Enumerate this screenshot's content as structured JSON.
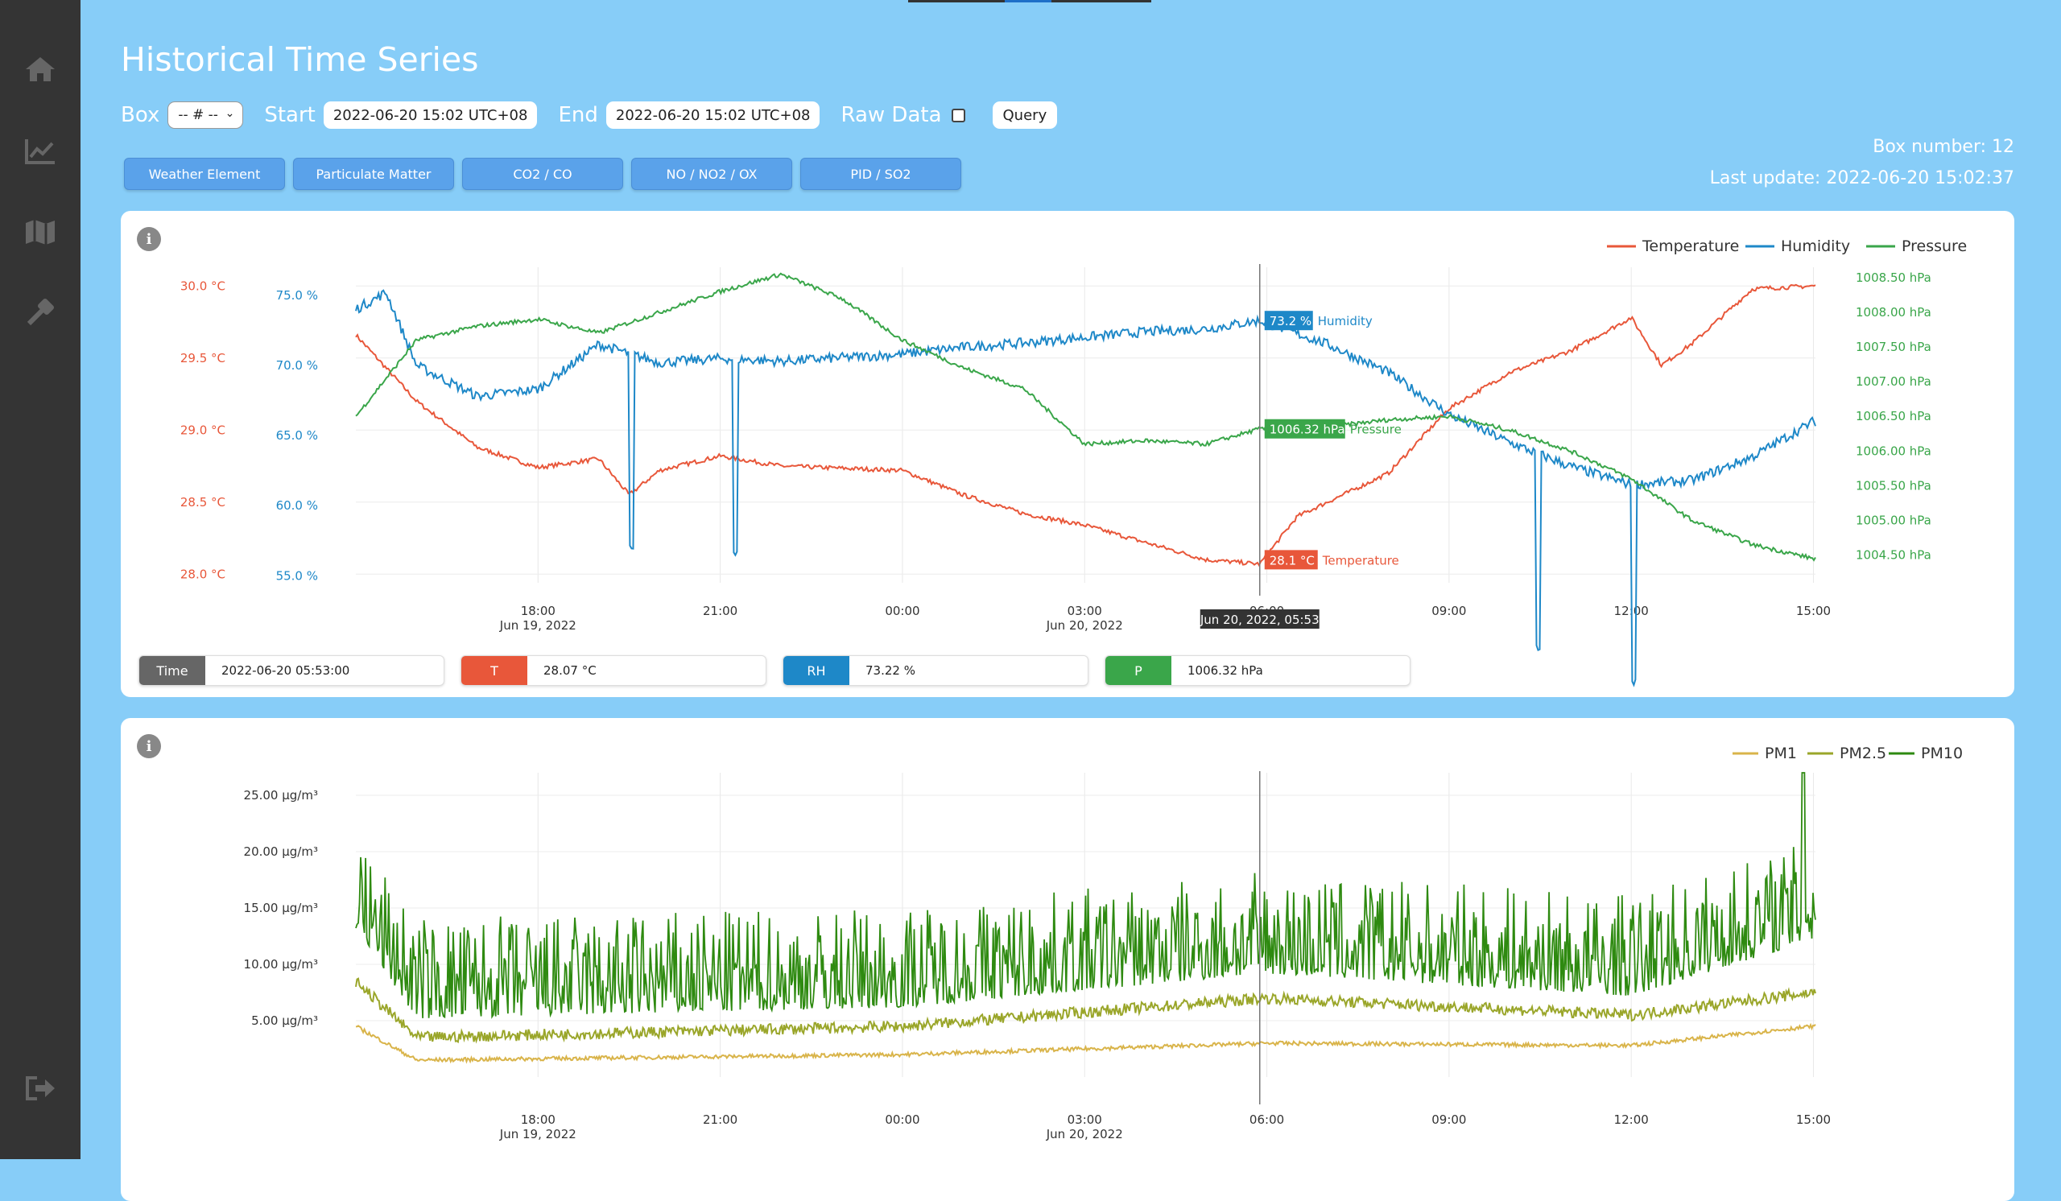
{
  "app": {
    "title": "Historical Time Series"
  },
  "sidebar": {
    "items": [
      {
        "icon": "home-icon"
      },
      {
        "icon": "chart-line-icon"
      },
      {
        "icon": "map-icon"
      },
      {
        "icon": "wrench-icon"
      }
    ],
    "logout_icon": "logout-icon"
  },
  "toolbar": {
    "box_label": "Box",
    "box_value": "-- # --",
    "start_label": "Start",
    "start_value": "2022-06-20 15:02 UTC+08",
    "end_label": "End",
    "end_value": "2022-06-20 15:02 UTC+08",
    "raw_label": "Raw Data",
    "raw_checked": false,
    "query_label": "Query"
  },
  "category_tabs": [
    "Weather Element",
    "Particulate Matter",
    "CO2 / CO",
    "NO / NO2 / OX",
    "PID / SO2"
  ],
  "box_info": {
    "box_number": "Box number: 12",
    "last_update": "Last update: 2022-06-20 15:02:37"
  },
  "colors": {
    "temperature": "#e8573a",
    "humidity": "#1e88c8",
    "pressure": "#3aa64a",
    "pm1": "#d9b44a",
    "pm25": "#9aa62a",
    "pm10": "#2e8a10",
    "time_tag": "#666666"
  },
  "x_axis": {
    "ticks": [
      "18:00",
      "21:00",
      "00:00",
      "03:00",
      "06:00",
      "09:00",
      "12:00",
      "15:00"
    ],
    "date_labels": [
      "Jun 19, 2022",
      "Jun 20, 2022"
    ],
    "range": [
      "2022-06-19 15:00",
      "2022-06-20 15:02"
    ]
  },
  "chart_data": [
    {
      "type": "line",
      "title": "",
      "legend": [
        "Temperature",
        "Humidity",
        "Pressure"
      ],
      "legend_position": "top-right",
      "cursor_label": "Jun 20, 2022, 05:53",
      "cursor_tags": {
        "humidity": "73.2 %",
        "humidity_name": "Humidity",
        "pressure": "1006.32 hPa",
        "pressure_name": "Pressure",
        "temperature": "28.1 °C",
        "temperature_name": "Temperature"
      },
      "axes": {
        "temperature": {
          "ticks": [
            "30.0 °C",
            "29.5 °C",
            "29.0 °C",
            "28.5 °C",
            "28.0 °C"
          ],
          "ylim": [
            27.94,
            30.13
          ]
        },
        "humidity": {
          "ticks": [
            "75.0 %",
            "70.0 %",
            "65.0 %",
            "60.0 %",
            "55.0 %"
          ],
          "ylim": [
            54.5,
            77.0
          ]
        },
        "pressure": {
          "ticks": [
            "1008.50 hPa",
            "1008.00 hPa",
            "1007.50 hPa",
            "1007.00 hPa",
            "1006.50 hPa",
            "1006.00 hPa",
            "1005.50 hPa",
            "1005.00 hPa",
            "1004.50 hPa"
          ],
          "ylim": [
            1004.1,
            1008.65
          ]
        }
      },
      "series": [
        {
          "name": "Temperature",
          "axis": "temperature",
          "x": [
            "2022-06-19 15:00",
            "2022-06-19 16:00",
            "2022-06-19 17:00",
            "2022-06-19 18:00",
            "2022-06-19 19:00",
            "2022-06-19 19:30",
            "2022-06-19 20:00",
            "2022-06-19 21:00",
            "2022-06-19 22:00",
            "2022-06-20 00:00",
            "2022-06-20 01:00",
            "2022-06-20 02:00",
            "2022-06-20 03:00",
            "2022-06-20 04:00",
            "2022-06-20 05:00",
            "2022-06-20 05:53",
            "2022-06-20 06:30",
            "2022-06-20 08:00",
            "2022-06-20 09:00",
            "2022-06-20 10:00",
            "2022-06-20 11:00",
            "2022-06-20 12:00",
            "2022-06-20 12:30",
            "2022-06-20 13:00",
            "2022-06-20 14:00",
            "2022-06-20 15:00"
          ],
          "values": [
            29.66,
            29.2,
            28.88,
            28.74,
            28.8,
            28.55,
            28.72,
            28.82,
            28.75,
            28.72,
            28.55,
            28.42,
            28.34,
            28.22,
            28.1,
            28.07,
            28.4,
            28.7,
            29.15,
            29.4,
            29.55,
            29.78,
            29.45,
            29.6,
            29.98,
            30.0
          ]
        },
        {
          "name": "Humidity",
          "axis": "humidity",
          "x": [
            "2022-06-19 15:00",
            "2022-06-19 15:30",
            "2022-06-19 16:00",
            "2022-06-19 17:00",
            "2022-06-19 18:00",
            "2022-06-19 19:00",
            "2022-06-19 20:00",
            "2022-06-19 21:00",
            "2022-06-19 22:00",
            "2022-06-20 00:00",
            "2022-06-20 01:00",
            "2022-06-20 02:00",
            "2022-06-20 03:00",
            "2022-06-20 04:00",
            "2022-06-20 05:00",
            "2022-06-20 05:53",
            "2022-06-20 07:00",
            "2022-06-20 08:00",
            "2022-06-20 09:00",
            "2022-06-20 10:00",
            "2022-06-20 11:00",
            "2022-06-20 12:00",
            "2022-06-20 13:00",
            "2022-06-20 14:00",
            "2022-06-20 15:00"
          ],
          "values": [
            74.0,
            75.2,
            70.0,
            67.8,
            68.3,
            71.5,
            70.2,
            70.5,
            70.3,
            70.8,
            71.3,
            71.6,
            72.0,
            72.4,
            72.6,
            73.2,
            71.5,
            69.5,
            66.5,
            64.5,
            62.8,
            61.5,
            61.8,
            63.5,
            66.0
          ]
        },
        {
          "name": "Pressure",
          "axis": "pressure",
          "x": [
            "2022-06-19 15:00",
            "2022-06-19 16:00",
            "2022-06-19 17:00",
            "2022-06-19 18:00",
            "2022-06-19 19:00",
            "2022-06-19 20:00",
            "2022-06-19 21:00",
            "2022-06-19 22:00",
            "2022-06-19 23:00",
            "2022-06-20 00:00",
            "2022-06-20 01:00",
            "2022-06-20 02:00",
            "2022-06-20 03:00",
            "2022-06-20 04:00",
            "2022-06-20 05:00",
            "2022-06-20 05:53",
            "2022-06-20 07:00",
            "2022-06-20 08:00",
            "2022-06-20 09:00",
            "2022-06-20 10:00",
            "2022-06-20 11:00",
            "2022-06-20 12:00",
            "2022-06-20 13:00",
            "2022-06-20 14:00",
            "2022-06-20 15:00"
          ],
          "values": [
            1006.5,
            1007.6,
            1007.8,
            1007.9,
            1007.7,
            1008.0,
            1008.3,
            1008.55,
            1008.2,
            1007.6,
            1007.2,
            1006.9,
            1006.1,
            1006.15,
            1006.1,
            1006.32,
            1006.35,
            1006.45,
            1006.5,
            1006.3,
            1006.0,
            1005.6,
            1005.0,
            1004.65,
            1004.45
          ]
        }
      ]
    },
    {
      "type": "line",
      "title": "",
      "legend": [
        "PM1",
        "PM2.5",
        "PM10"
      ],
      "legend_position": "top-right",
      "y_ticks": [
        "25.00 µg/m³",
        "20.00 µg/m³",
        "15.00 µg/m³",
        "10.00 µg/m³",
        "5.00 µg/m³"
      ],
      "ylim": [
        0,
        27.0
      ],
      "series": [
        {
          "name": "PM1",
          "base": [
            "2022-06-19 15:00:4.5",
            "2022-06-19 16:00:1.5",
            "2022-06-20 00:00:2.0",
            "2022-06-20 06:00:3.0",
            "2022-06-20 12:00:2.8",
            "2022-06-20 15:00:4.5"
          ]
        },
        {
          "name": "PM2.5",
          "base": [
            "2022-06-19 15:00:8.5",
            "2022-06-19 16:00:3.5",
            "2022-06-20 00:00:4.5",
            "2022-06-20 06:00:7.0",
            "2022-06-20 12:00:5.5",
            "2022-06-20 15:00:7.5"
          ]
        },
        {
          "name": "PM10",
          "base": [
            "2022-06-19 15:00:15",
            "2022-06-19 16:00:7",
            "2022-06-20 00:00:8",
            "2022-06-20 06:00:11",
            "2022-06-20 12:00:9",
            "2022-06-20 15:00:14"
          ],
          "peak": "2022-06-20 14:50:27.0"
        }
      ]
    }
  ],
  "readouts": [
    {
      "tag": "Time",
      "value": "2022-06-20 05:53:00"
    },
    {
      "tag": "T",
      "value": "28.07 °C"
    },
    {
      "tag": "RH",
      "value": "73.22 %"
    },
    {
      "tag": "P",
      "value": "1006.32 hPa"
    }
  ]
}
